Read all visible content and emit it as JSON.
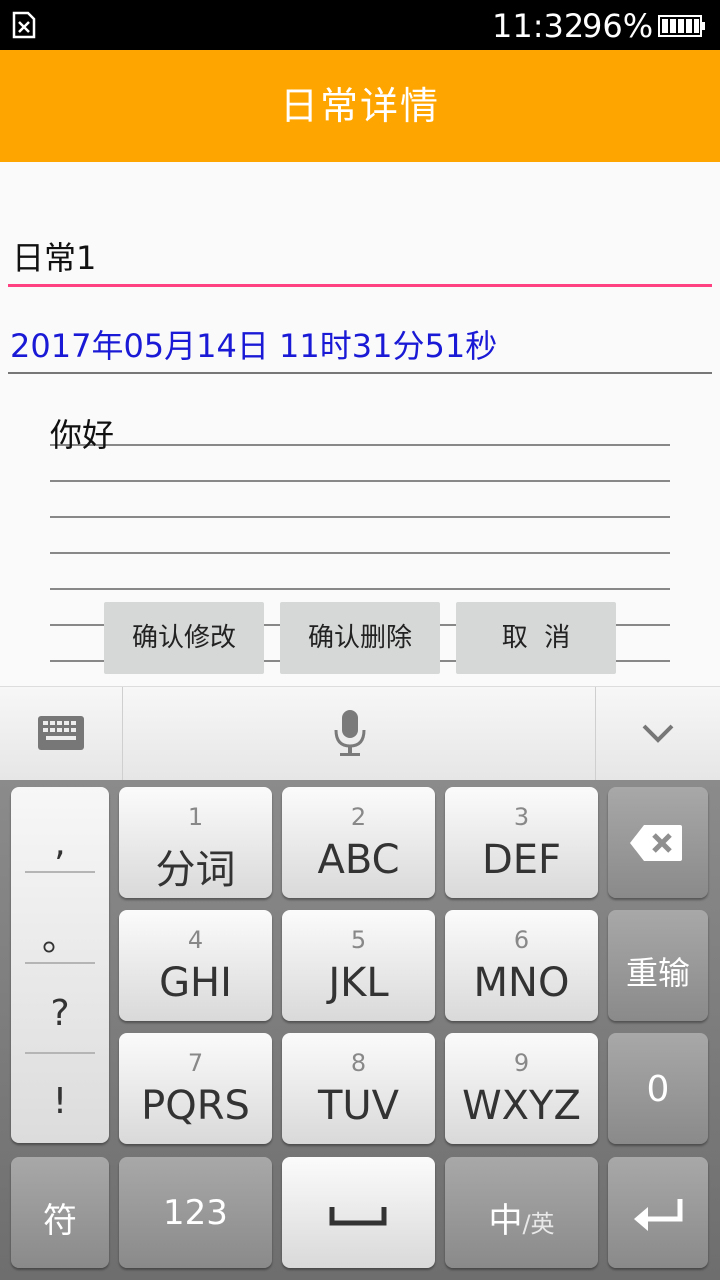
{
  "status_bar": {
    "time": "11:32",
    "battery_percent": "96%"
  },
  "app_bar": {
    "title": "日常详情"
  },
  "form": {
    "title_value": "日常1",
    "date_text": "2017年05月14日 11时31分51秒",
    "content_text": "你好"
  },
  "actions": {
    "confirm_edit": "确认修改",
    "confirm_delete": "确认删除",
    "cancel": "取  消"
  },
  "keyboard": {
    "punctuation": [
      ",",
      "。",
      "?",
      "!"
    ],
    "keys": [
      {
        "num": "1",
        "letters": "分词"
      },
      {
        "num": "2",
        "letters": "ABC"
      },
      {
        "num": "3",
        "letters": "DEF"
      },
      {
        "num": "4",
        "letters": "GHI"
      },
      {
        "num": "5",
        "letters": "JKL"
      },
      {
        "num": "6",
        "letters": "MNO"
      },
      {
        "num": "7",
        "letters": "PQRS"
      },
      {
        "num": "8",
        "letters": "TUV"
      },
      {
        "num": "9",
        "letters": "WXYZ"
      }
    ],
    "retype": "重输",
    "zero": "0",
    "symbols": "符",
    "numeric": "123",
    "lang_main": "中",
    "lang_alt": "/英"
  }
}
